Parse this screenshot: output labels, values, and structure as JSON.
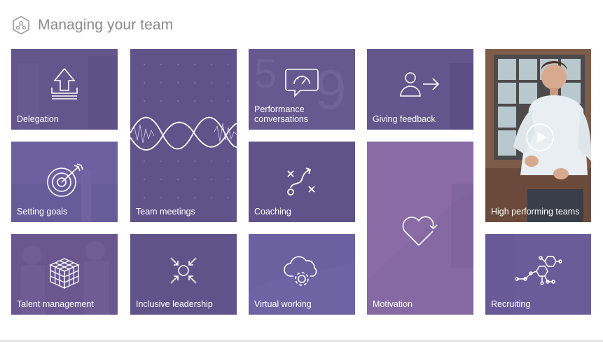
{
  "header": {
    "title": "Managing your team",
    "logo_icon": "hexagon-team-icon"
  },
  "tiles": {
    "delegation": {
      "label": "Delegation",
      "icon": "delegation-arrow-icon"
    },
    "team_meetings": {
      "label": "Team meetings",
      "icon": "waveform-icon"
    },
    "performance": {
      "label": "Performance\nconversations",
      "icon": "gauge-speech-bubble-icon"
    },
    "giving_feedback": {
      "label": "Giving feedback",
      "icon": "person-arrow-icon"
    },
    "high_performing": {
      "label": "High performing teams",
      "icon": "play-icon"
    },
    "setting_goals": {
      "label": "Setting goals",
      "icon": "target-icon"
    },
    "coaching": {
      "label": "Coaching",
      "icon": "tactics-play-icon"
    },
    "motivation": {
      "label": "Motivation",
      "icon": "heart-cycle-icon"
    },
    "talent_management": {
      "label": "Talent management",
      "icon": "cube-grid-icon"
    },
    "inclusive_leadership": {
      "label": "Inclusive leadership",
      "icon": "converging-arrows-icon"
    },
    "virtual_working": {
      "label": "Virtual working",
      "icon": "cloud-gear-icon"
    },
    "recruiting": {
      "label": "Recruiting",
      "icon": "molecule-icon"
    }
  },
  "colors": {
    "tile_primary": "#5f5389",
    "tile_light": "#7766a3",
    "tile_motivation": "#8a6aa6",
    "title_text": "#8a8a8a"
  }
}
